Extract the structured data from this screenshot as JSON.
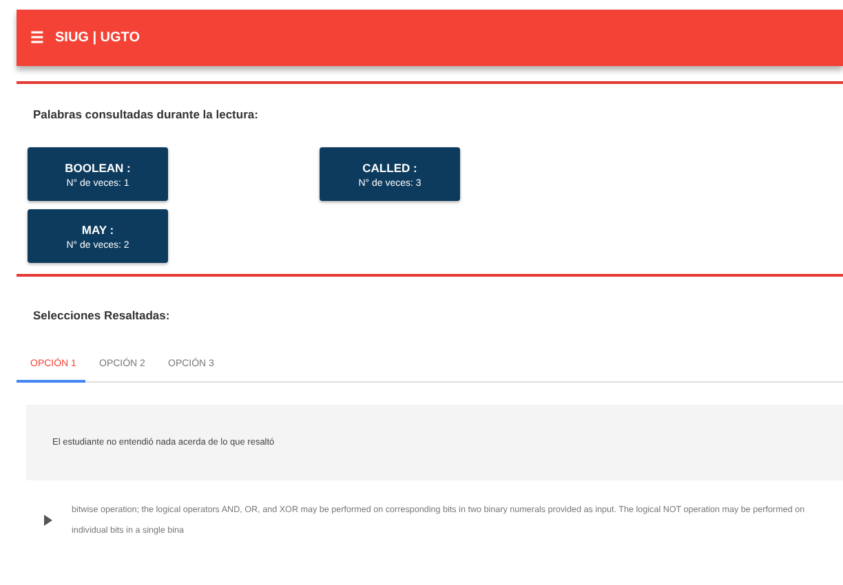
{
  "app_bar": {
    "menu_icon": "☰",
    "title": "SIUG | UGTO"
  },
  "words_section": {
    "heading": "Palabras consultadas durante la lectura:",
    "words": [
      {
        "word": "BOOLEAN :",
        "count": "N° de veces: 1"
      },
      {
        "word": "CALLED :",
        "count": "N° de veces: 3"
      },
      {
        "word": "MAY :",
        "count": "N° de veces: 2"
      }
    ]
  },
  "highlights_section": {
    "heading": "Selecciones Resaltadas:",
    "tabs": [
      {
        "label": "OPCIÓN 1",
        "selected": true
      },
      {
        "label": "OPCIÓN 2",
        "selected": false
      },
      {
        "label": "OPCIÓN 3",
        "selected": false
      }
    ],
    "comment": "El estudiante no entendió nada acerda de lo que resaltó",
    "excerpt": {
      "expanded": false,
      "text": "bitwise operation; the logical operators AND, OR, and XOR may be performed on corresponding bits in two binary numerals provided as input. The logical NOT operation may be performed on individual bits in a single bina"
    }
  }
}
